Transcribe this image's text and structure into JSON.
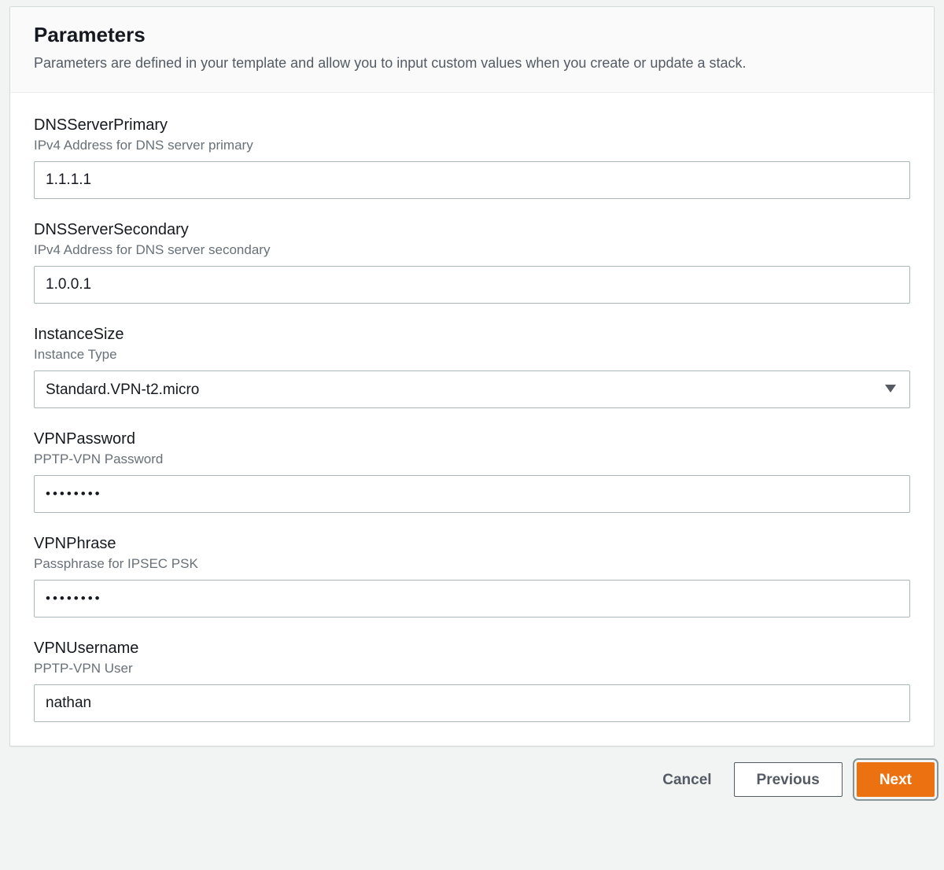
{
  "header": {
    "title": "Parameters",
    "subtitle": "Parameters are defined in your template and allow you to input custom values when you create or update a stack."
  },
  "fields": {
    "dnsPrimary": {
      "label": "DNSServerPrimary",
      "hint": "IPv4 Address for DNS server primary",
      "value": "1.1.1.1"
    },
    "dnsSecondary": {
      "label": "DNSServerSecondary",
      "hint": "IPv4 Address for DNS server secondary",
      "value": "1.0.0.1"
    },
    "instanceSize": {
      "label": "InstanceSize",
      "hint": "Instance Type",
      "value": "Standard.VPN-t2.micro"
    },
    "vpnPassword": {
      "label": "VPNPassword",
      "hint": "PPTP-VPN Password",
      "value": "••••••••"
    },
    "vpnPhrase": {
      "label": "VPNPhrase",
      "hint": "Passphrase for IPSEC PSK",
      "value": "••••••••"
    },
    "vpnUsername": {
      "label": "VPNUsername",
      "hint": "PPTP-VPN User",
      "value": "nathan"
    }
  },
  "footer": {
    "cancel": "Cancel",
    "previous": "Previous",
    "next": "Next"
  }
}
